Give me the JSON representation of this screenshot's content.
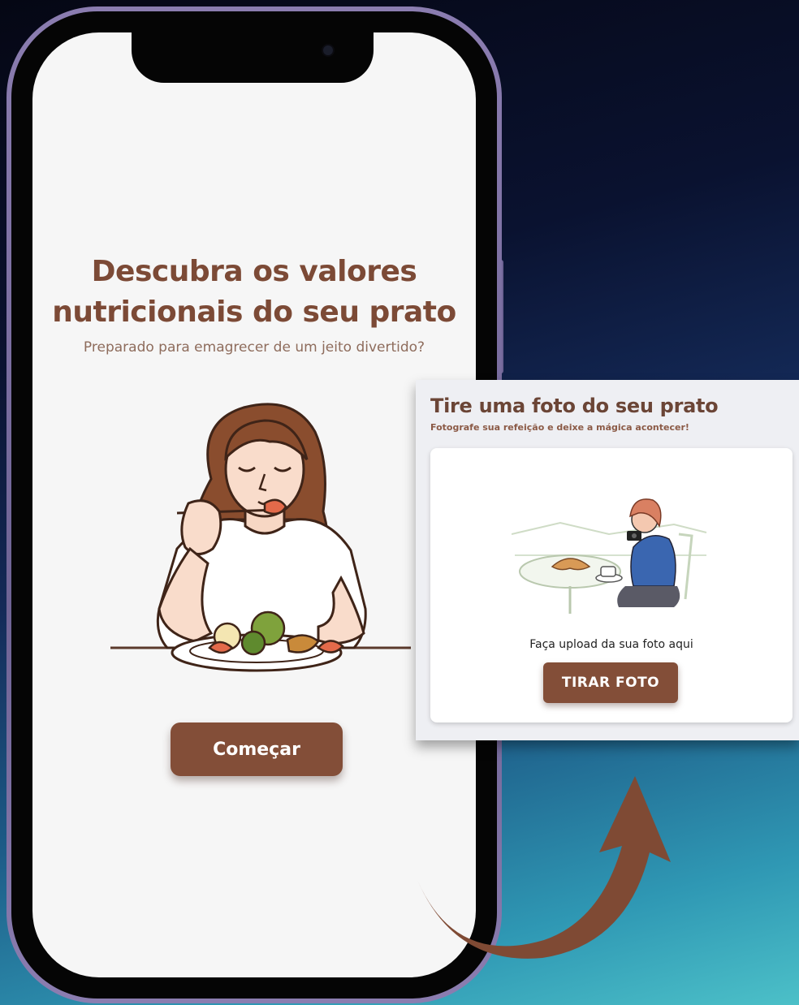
{
  "home_screen": {
    "headline_line1": "Descubra os valores",
    "headline_line2": "nutricionais do seu prato",
    "subtitle": "Preparado para emagrecer de um jeito divertido?",
    "start_button": "Começar"
  },
  "photo_screen": {
    "title": "Tire uma foto do seu prato",
    "subtitle": "Fotografe sua refeição e deixe a mágica acontecer!",
    "upload_text": "Faça upload da sua foto aqui",
    "photo_button": "TIRAR FOTO"
  },
  "colors": {
    "brand_brown": "#834e38",
    "headline_brown": "#7c4a36",
    "screen_background": "#f6f6f6",
    "phone_frame": "#8b7db0"
  },
  "icons": {
    "home_illustration": "woman-eating-salad-illustration",
    "card_illustration": "woman-photographing-food-illustration",
    "transition_arrow": "curved-arrow-icon"
  }
}
